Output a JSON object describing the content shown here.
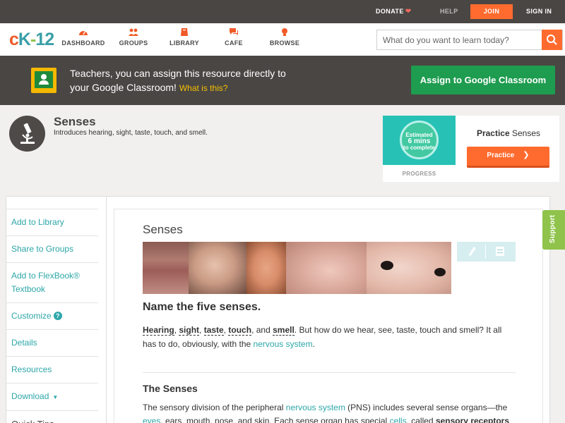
{
  "topbar": {
    "donate": "DONATE",
    "help": "HELP",
    "join": "JOIN",
    "signin": "SIGN IN"
  },
  "nav": {
    "items": [
      "DASHBOARD",
      "GROUPS",
      "LIBRARY",
      "CAFE",
      "BROWSE"
    ],
    "search_placeholder": "What do you want to learn today?"
  },
  "banner": {
    "line1": "Teachers, you can assign this resource directly to",
    "line2": "your Google Classroom!",
    "what_is_this": "What is this?",
    "assign_button": "Assign to Google Classroom"
  },
  "concept": {
    "title": "Senses",
    "description": "Introduces hearing, sight, taste, touch, and smell."
  },
  "practice": {
    "ring_line1": "Estimated",
    "ring_line2": "6 mins",
    "ring_line3": "to complete",
    "progress_label": "PROGRESS",
    "heading_bold": "Practice",
    "heading_rest": "Senses",
    "button": "Practice"
  },
  "sidebar": {
    "items": [
      "Add to Library",
      "Share to Groups",
      "Add to FlexBook® Textbook",
      "Customize",
      "Details",
      "Resources",
      "Download"
    ],
    "quick_tips": "Quick Tips"
  },
  "article": {
    "title": "Senses",
    "heading": "Name the five senses.",
    "senses": [
      "Hearing",
      "sight",
      "taste",
      "touch",
      "smell"
    ],
    "intro_rest": "But how do we hear, see, taste, touch and smell? It all has to do, obviously, with the",
    "nervous_system_link": "nervous system",
    "section_heading": "The Senses",
    "p2_a": "The sensory division of the peripheral",
    "p2_link1": "nervous system",
    "p2_b": "(PNS) includes several sense organs—the",
    "p2_link2": "eyes",
    "p2_c": ", ears, mouth, nose, and skin. Each sense organ has special",
    "p2_link3": "cells",
    "p2_d": ", called",
    "p2_bold": "sensory receptors"
  },
  "support_tab": "Support",
  "colors": {
    "brand_orange": "#ff6b2f",
    "teal": "#2da6a8",
    "green_button": "#1e9c4f",
    "dark_bar": "#4a4644"
  }
}
